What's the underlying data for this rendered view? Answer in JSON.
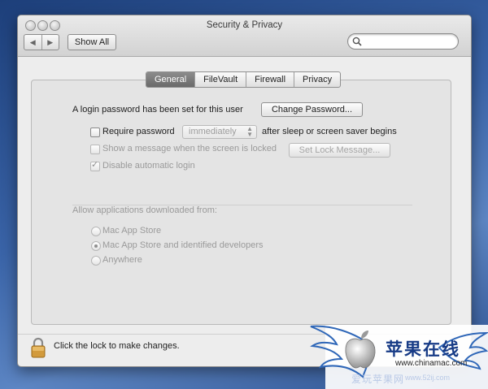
{
  "window": {
    "title": "Security & Privacy",
    "nav_back": "◀",
    "nav_forward": "▶",
    "show_all": "Show All",
    "search_value": ""
  },
  "tabs": [
    {
      "label": "General",
      "active": true
    },
    {
      "label": "FileVault",
      "active": false
    },
    {
      "label": "Firewall",
      "active": false
    },
    {
      "label": "Privacy",
      "active": false
    }
  ],
  "general": {
    "login_text": "A login password has been set for this user",
    "change_password": "Change Password...",
    "require_password": {
      "label": "Require password",
      "checked": false,
      "select_value": "immediately",
      "suffix": "after sleep or screen saver begins"
    },
    "show_message": {
      "label": "Show a message when the screen is locked",
      "checked": false,
      "button": "Set Lock Message..."
    },
    "disable_login": {
      "label": "Disable automatic login",
      "checked": true
    }
  },
  "allow_apps": {
    "heading": "Allow applications downloaded from:",
    "options": [
      {
        "label": "Mac App Store",
        "selected": false
      },
      {
        "label": "Mac App Store and identified developers",
        "selected": true
      },
      {
        "label": "Anywhere",
        "selected": false
      }
    ]
  },
  "footer": {
    "lock_text": "Click the lock to make changes.",
    "lock_icon": "padlock-icon"
  },
  "watermark": {
    "title": "苹果在线",
    "url": "www.chinamac.com",
    "faint": "爱玩苹果网",
    "faint_url": "www.52ij.com"
  },
  "colors": {
    "desktop": "#3a64a8",
    "window": "#ededed",
    "tab_active": "#7a7a7a",
    "watermark_text": "#173b86"
  }
}
